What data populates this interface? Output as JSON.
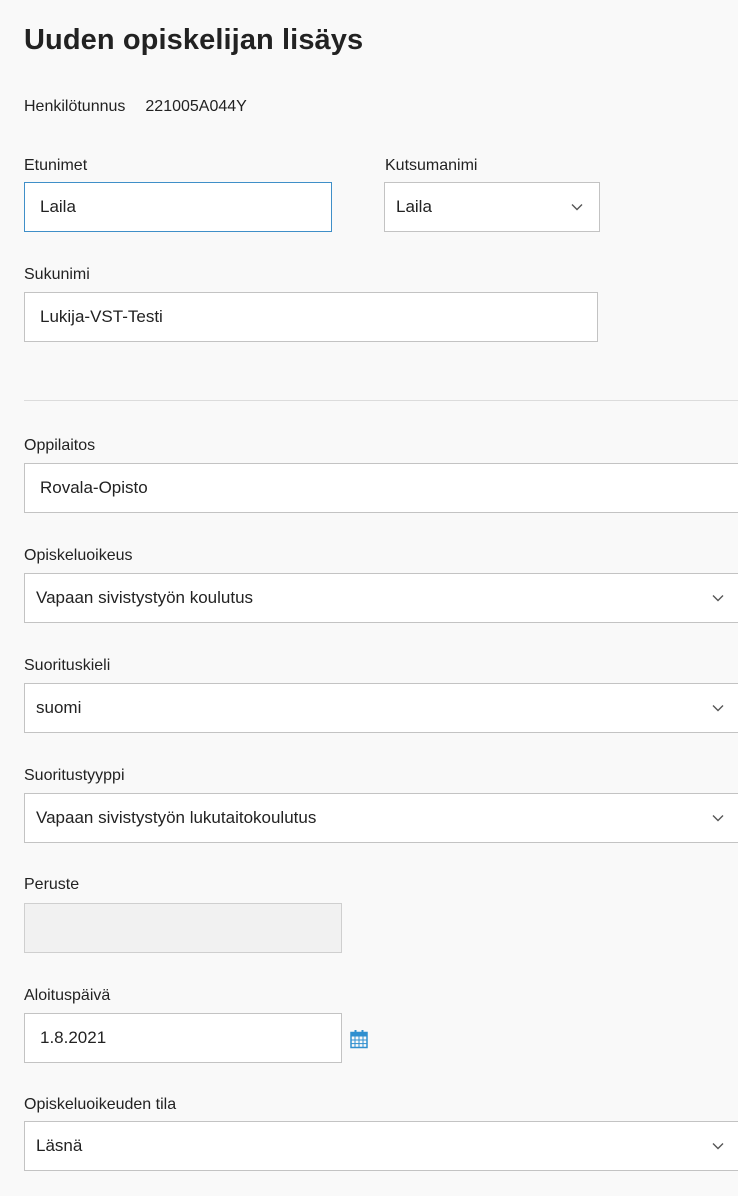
{
  "page": {
    "title": "Uuden opiskelijan lisäys"
  },
  "ssn": {
    "label": "Henkilötunnus",
    "value": "221005A044Y"
  },
  "first_names": {
    "label": "Etunimet",
    "value": "Laila"
  },
  "call_name": {
    "label": "Kutsumanimi",
    "value": "Laila"
  },
  "last_name": {
    "label": "Sukunimi",
    "value": "Lukija-VST-Testi"
  },
  "institution": {
    "label": "Oppilaitos",
    "value": "Rovala-Opisto"
  },
  "study_right": {
    "label": "Opiskeluoikeus",
    "value": "Vapaan sivistystyön koulutus"
  },
  "language": {
    "label": "Suorituskieli",
    "value": "suomi"
  },
  "completion_type": {
    "label": "Suoritustyyppi",
    "value": "Vapaan sivistystyön lukutaitokoulutus"
  },
  "basis": {
    "label": "Peruste",
    "value": ""
  },
  "start_date": {
    "label": "Aloituspäivä",
    "value": "1.8.2021"
  },
  "study_right_state": {
    "label": "Opiskeluoikeuden tila",
    "value": "Läsnä"
  },
  "colors": {
    "focus_border": "#3f8fc8",
    "input_border": "#c3c3c3",
    "calendar_icon": "#2f8fcf",
    "background": "#f9f9f9"
  },
  "icons": {
    "dropdown": "chevron-down-icon",
    "date_picker": "calendar-icon"
  }
}
